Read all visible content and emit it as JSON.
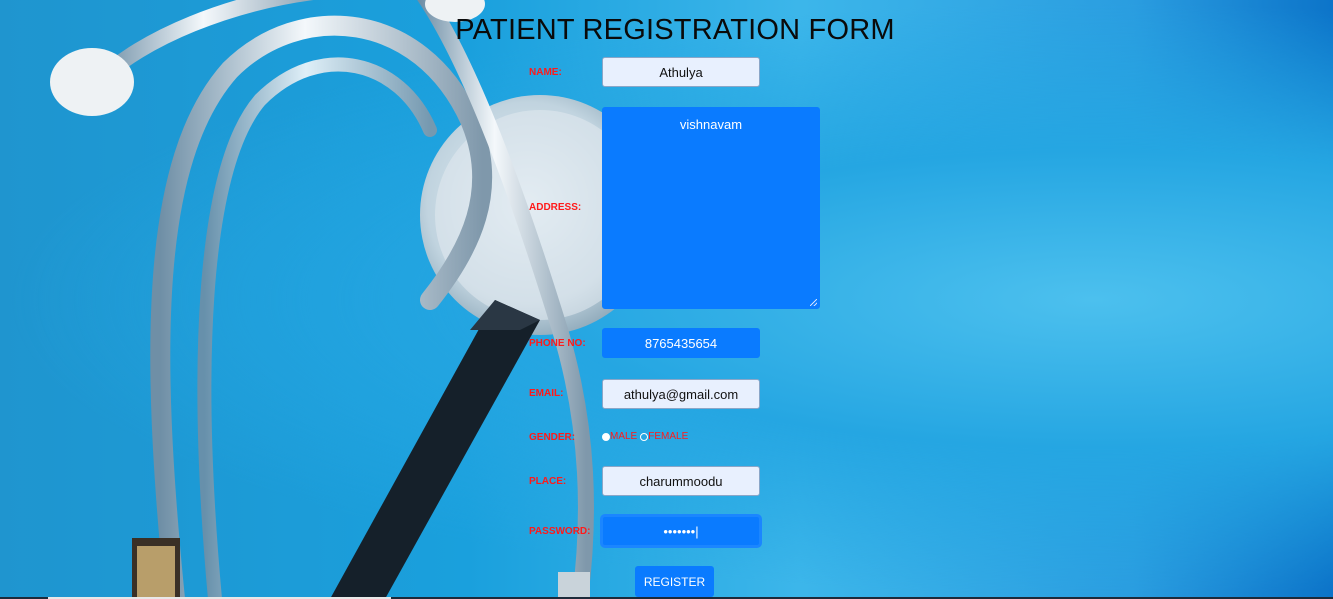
{
  "form": {
    "title": "PATIENT REGISTRATION FORM",
    "labels": {
      "name": "NAME:",
      "address": "ADDRESS:",
      "phone": "PHONE NO:",
      "email": "EMAIL:",
      "gender": "GENDER:",
      "place": "PLACE:",
      "password": "PASSWORD:"
    },
    "values": {
      "name": "Athulya",
      "address": "vishnavam",
      "phone": "8765435654",
      "email": "athulya@gmail.com",
      "place": "charummoodu",
      "password": "•••••••|"
    },
    "gender": {
      "options": [
        "MALE",
        "FEMALE"
      ],
      "selected": "MALE"
    },
    "register_label": "REGISTER"
  },
  "colors": {
    "label": "#ff1a1a",
    "accent": "#0a7bff",
    "input_bg": "#e8f0fe",
    "title": "#0a0a0a"
  },
  "icons": {
    "background": "stethoscope-image"
  }
}
